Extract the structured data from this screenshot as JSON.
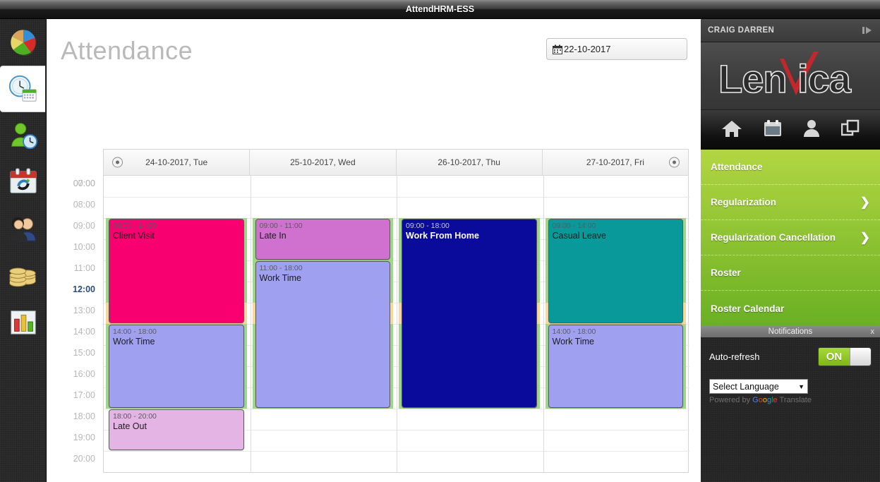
{
  "window": {
    "title": "AttendHRM-ESS"
  },
  "left_rail": {
    "items": [
      {
        "name": "dashboard",
        "icon": "pie-chart-icon",
        "active": false
      },
      {
        "name": "attendance",
        "icon": "clock-calendar-icon",
        "active": true
      },
      {
        "name": "employee-time",
        "icon": "person-clock-icon",
        "active": false
      },
      {
        "name": "leave-calendar",
        "icon": "calendar-refresh-icon",
        "active": false
      },
      {
        "name": "employees",
        "icon": "people-icon",
        "active": false
      },
      {
        "name": "payroll",
        "icon": "coins-icon",
        "active": false
      },
      {
        "name": "reports",
        "icon": "bar-chart-icon",
        "active": false
      }
    ]
  },
  "page": {
    "title": "Attendance",
    "date_value": "22-10-2017",
    "date_icon": "calendar-icon"
  },
  "calendar": {
    "prev_label": "prev-day",
    "next_label": "next-day",
    "columns": [
      "24-10-2017, Tue",
      "25-10-2017, Wed",
      "26-10-2017, Thu",
      "27-10-2017, Fri"
    ],
    "time_labels": [
      "00:00",
      "08:00",
      "09:00",
      "10:00",
      "11:00",
      "12:00",
      "13:00",
      "14:00",
      "15:00",
      "16:00",
      "17:00",
      "18:00",
      "19:00",
      "20:00"
    ],
    "overlap_label": "07:00",
    "highlighted_time": "12:00",
    "shift_band": {
      "start": "09:00",
      "end": "18:00",
      "color": "#9fd68a"
    },
    "break_band": {
      "start": "13:00",
      "end": "14:00",
      "color": "#f6d79c"
    },
    "events": [
      {
        "col": 0,
        "start": "09:00",
        "end": "14:00",
        "time": "09:00 - 14:00",
        "name": "Client Visit",
        "color": "#f80070",
        "dark": false
      },
      {
        "col": 0,
        "start": "14:00",
        "end": "18:00",
        "time": "14:00 - 18:00",
        "name": "Work Time",
        "color": "#a0a0f0",
        "dark": false
      },
      {
        "col": 0,
        "start": "18:00",
        "end": "20:00",
        "time": "18:00 - 20:00",
        "name": "Late Out",
        "color": "#e4b4e4",
        "dark": false
      },
      {
        "col": 1,
        "start": "09:00",
        "end": "11:00",
        "time": "09:00 - 11:00",
        "name": "Late In",
        "color": "#d071d0",
        "dark": false
      },
      {
        "col": 1,
        "start": "11:00",
        "end": "18:00",
        "time": "11:00 - 18:00",
        "name": "Work Time",
        "color": "#a0a0f0",
        "dark": false
      },
      {
        "col": 2,
        "start": "09:00",
        "end": "18:00",
        "time": "09:00 - 18:00",
        "name": "Work From Home",
        "color": "#0a0a9b",
        "dark": true
      },
      {
        "col": 3,
        "start": "09:00",
        "end": "14:00",
        "time": "09:00 - 14:00",
        "name": "Casual Leave",
        "color": "#09999b",
        "dark": false
      },
      {
        "col": 3,
        "start": "14:00",
        "end": "18:00",
        "time": "14:00 - 18:00",
        "name": "Work Time",
        "color": "#a0a0f0",
        "dark": false
      }
    ]
  },
  "right_panel": {
    "user": "CRAIG DARREN",
    "collapse_icon": "collapse-panel-icon",
    "logo_text": "Lenvica",
    "nav_icons": [
      {
        "name": "home-icon"
      },
      {
        "name": "calendar-icon"
      },
      {
        "name": "person-icon"
      },
      {
        "name": "windows-icon"
      }
    ],
    "menu": [
      {
        "label": "Attendance",
        "chevron": ""
      },
      {
        "label": "Regularization",
        "chevron": "❯"
      },
      {
        "label": "Regularization Cancellation",
        "chevron": "❯"
      },
      {
        "label": "Roster",
        "chevron": ""
      },
      {
        "label": "Roster Calendar",
        "chevron": ""
      }
    ],
    "notifications": {
      "title": "Notifications",
      "close": "x",
      "autorefresh_label": "Auto-refresh",
      "toggle_state": "ON",
      "language_value": "Select Language",
      "language_caret": "▼",
      "powered_prefix": "Powered by ",
      "powered_brand": "Google",
      "powered_suffix": " Translate"
    }
  },
  "theme": {
    "accent_green": "#9fd68a",
    "menu_green_top": "#b2d642",
    "menu_green_bottom": "#6ab023",
    "toggle_green": "#8fc51f",
    "highlight_blue": "#2a4d7a"
  }
}
